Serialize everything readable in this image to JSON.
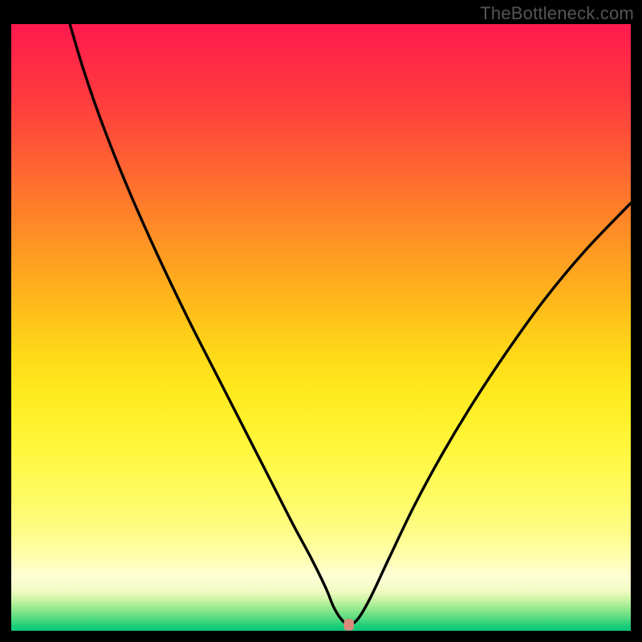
{
  "watermark": "TheBottleneck.com",
  "chart_data": {
    "type": "line",
    "title": "",
    "xlabel": "",
    "ylabel": "",
    "xlim": [
      0,
      1
    ],
    "ylim": [
      0,
      1
    ],
    "legend": false,
    "grid": false,
    "background": "vertical-gradient-red-yellow-green",
    "series": [
      {
        "name": "bottleneck-curve",
        "color": "#000000",
        "x": [
          0.095,
          0.115,
          0.14,
          0.17,
          0.205,
          0.245,
          0.29,
          0.335,
          0.38,
          0.42,
          0.455,
          0.485,
          0.508,
          0.52,
          0.532,
          0.545,
          0.56,
          0.58,
          0.61,
          0.65,
          0.695,
          0.745,
          0.8,
          0.86,
          0.925,
          1.0
        ],
        "y": [
          0.999,
          0.93,
          0.855,
          0.775,
          0.69,
          0.6,
          0.505,
          0.415,
          0.325,
          0.245,
          0.175,
          0.118,
          0.07,
          0.04,
          0.02,
          0.01,
          0.02,
          0.055,
          0.12,
          0.205,
          0.29,
          0.375,
          0.46,
          0.545,
          0.625,
          0.705
        ]
      }
    ],
    "marker": {
      "name": "optimal-point",
      "shape": "rounded-rect",
      "color": "#d98a7a",
      "x": 0.545,
      "y": 0.01
    }
  }
}
